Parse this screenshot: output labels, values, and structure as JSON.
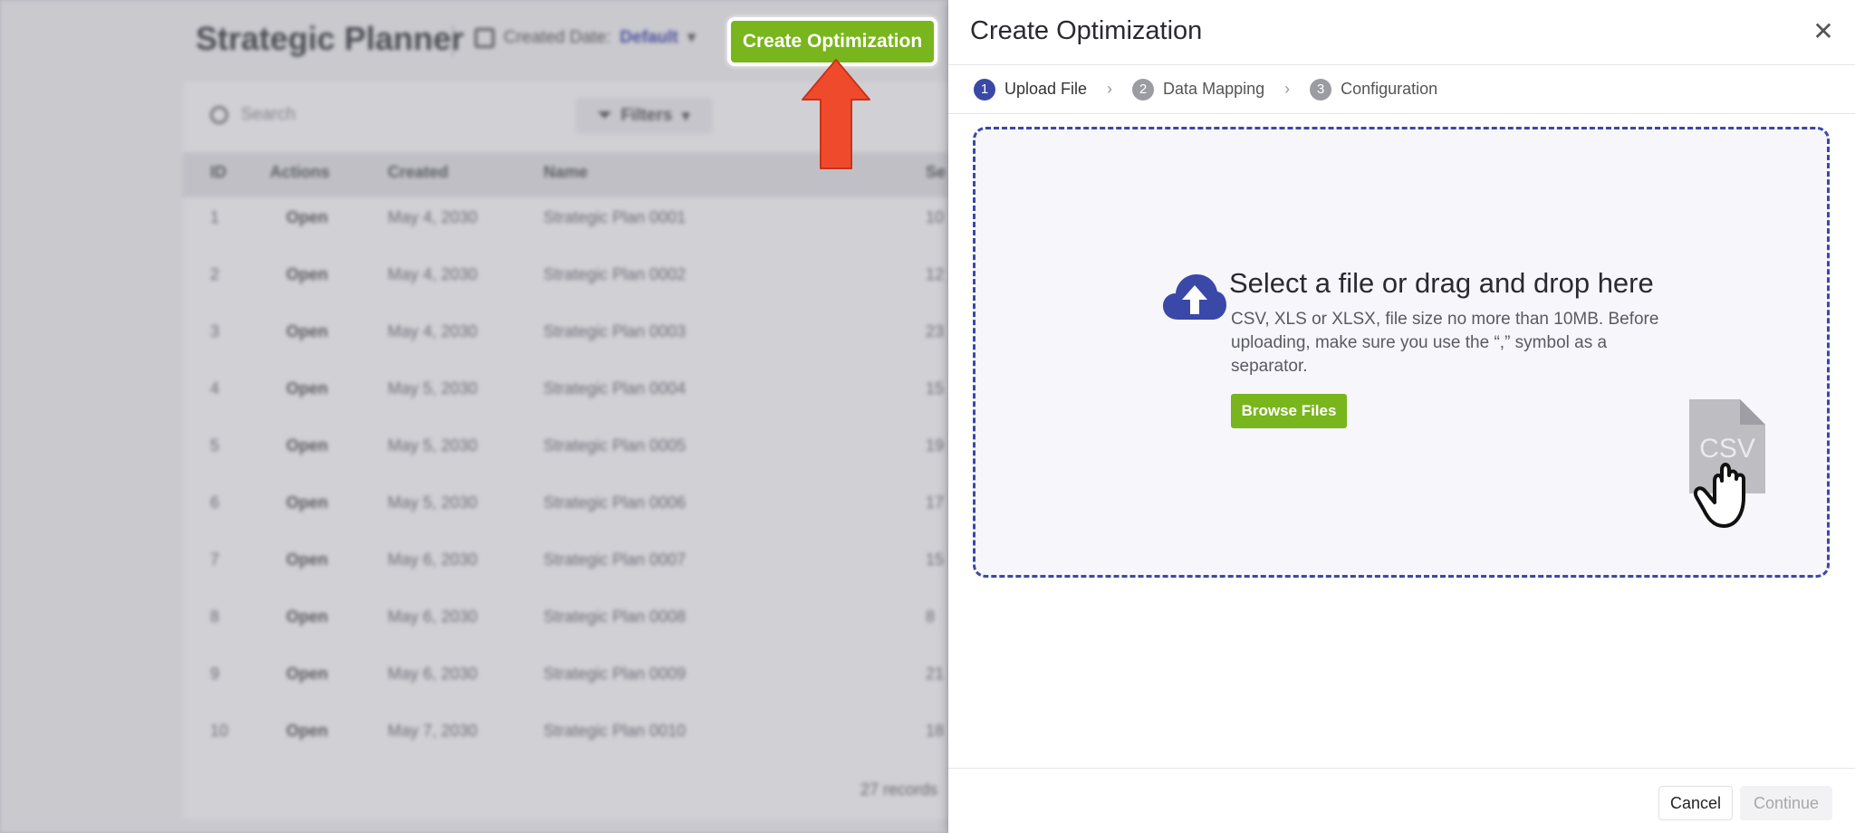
{
  "background_app": {
    "title": "Strategic Planner",
    "date_filter_label": "Created Date:",
    "date_filter_value": "Default",
    "search_placeholder": "Search",
    "filters_label": "Filters",
    "columns": [
      "ID",
      "Actions",
      "Created",
      "Name",
      "Se"
    ],
    "rows": [
      {
        "id": "1",
        "action": "Open",
        "created": "May 4, 2030",
        "name": "Strategic Plan 0001",
        "extra": "10"
      },
      {
        "id": "2",
        "action": "Open",
        "created": "May 4, 2030",
        "name": "Strategic Plan 0002",
        "extra": "12"
      },
      {
        "id": "3",
        "action": "Open",
        "created": "May 4, 2030",
        "name": "Strategic Plan 0003",
        "extra": "23"
      },
      {
        "id": "4",
        "action": "Open",
        "created": "May 5, 2030",
        "name": "Strategic Plan 0004",
        "extra": "15"
      },
      {
        "id": "5",
        "action": "Open",
        "created": "May 5, 2030",
        "name": "Strategic Plan 0005",
        "extra": "19"
      },
      {
        "id": "6",
        "action": "Open",
        "created": "May 5, 2030",
        "name": "Strategic Plan 0006",
        "extra": "17"
      },
      {
        "id": "7",
        "action": "Open",
        "created": "May 6, 2030",
        "name": "Strategic Plan 0007",
        "extra": "15"
      },
      {
        "id": "8",
        "action": "Open",
        "created": "May 6, 2030",
        "name": "Strategic Plan 0008",
        "extra": "8"
      },
      {
        "id": "9",
        "action": "Open",
        "created": "May 6, 2030",
        "name": "Strategic Plan 0009",
        "extra": "21"
      },
      {
        "id": "10",
        "action": "Open",
        "created": "May 7, 2030",
        "name": "Strategic Plan 0010",
        "extra": "18"
      }
    ],
    "footer_text": "27 records",
    "create_button_label": "Create Optimization"
  },
  "drawer": {
    "title": "Create Optimization",
    "close_icon": "close-icon",
    "steps": [
      {
        "num": "1",
        "label": "Upload File",
        "active": true
      },
      {
        "num": "2",
        "label": "Data Mapping",
        "active": false
      },
      {
        "num": "3",
        "label": "Configuration",
        "active": false
      }
    ],
    "dropzone": {
      "title": "Select a file or drag and drop here",
      "description": "CSV, XLS or XLSX, file size no more than 10MB. Before uploading, make sure you use the “,” symbol as a separator.",
      "browse_label": "Browse Files",
      "file_badge": "CSV"
    },
    "footer": {
      "cancel_label": "Cancel",
      "continue_label": "Continue"
    }
  },
  "colors": {
    "accent_blue": "#3a48a8",
    "accent_green": "#79b51c",
    "arrow_red": "#f04a2c"
  }
}
